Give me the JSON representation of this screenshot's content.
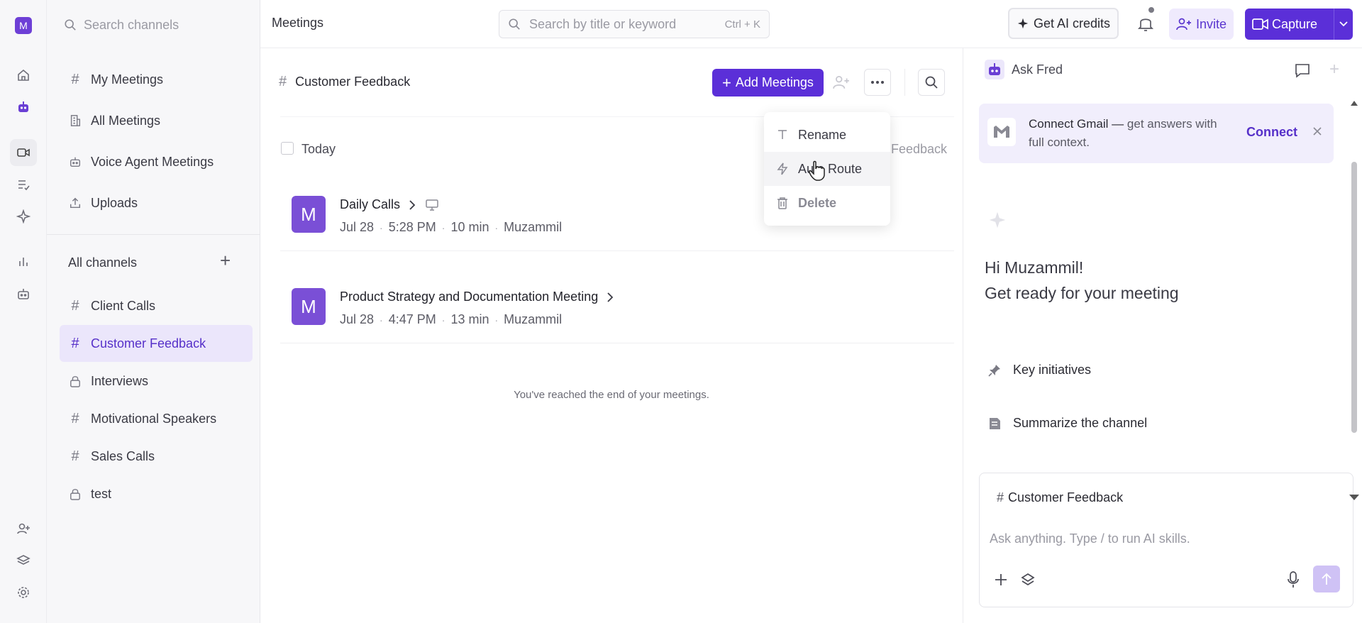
{
  "workspace": {
    "initial": "M"
  },
  "sidebar": {
    "search_placeholder": "Search channels",
    "nav": [
      {
        "label": "My Meetings",
        "icon": "hash-icon"
      },
      {
        "label": "All Meetings",
        "icon": "building-icon"
      },
      {
        "label": "Voice Agent Meetings",
        "icon": "robot-icon"
      },
      {
        "label": "Uploads",
        "icon": "upload-icon"
      }
    ],
    "channels_header": "All channels",
    "channels": [
      {
        "label": "Client Calls",
        "icon": "hash-icon"
      },
      {
        "label": "Customer Feedback",
        "icon": "hash-icon",
        "active": true
      },
      {
        "label": "Interviews",
        "icon": "lock-icon"
      },
      {
        "label": "Motivational Speakers",
        "icon": "hash-icon"
      },
      {
        "label": "Sales Calls",
        "icon": "hash-icon"
      },
      {
        "label": "test",
        "icon": "lock-icon"
      }
    ]
  },
  "topbar": {
    "title": "Meetings",
    "search_placeholder": "Search by title or keyword",
    "search_shortcut": "Ctrl + K",
    "ai_credits_label": "Get AI credits",
    "invite_label": "Invite",
    "capture_label": "Capture"
  },
  "main": {
    "channel_title": "Customer Feedback",
    "add_meetings_label": "Add Meetings",
    "group_label": "Today",
    "partial_label": "Feedback",
    "meetings": [
      {
        "avatar": "M",
        "title": "Daily Calls",
        "date": "Jul 28",
        "time": "5:28 PM",
        "duration": "10 min",
        "owner": "Muzammil"
      },
      {
        "avatar": "M",
        "title": "Product Strategy and Documentation Meeting",
        "date": "Jul 28",
        "time": "4:47 PM",
        "duration": "13 min",
        "owner": "Muzammil"
      }
    ],
    "end_text": "You've reached the end of your meetings."
  },
  "menu": {
    "items": [
      {
        "label": "Rename",
        "icon": "text-icon"
      },
      {
        "label": "Auto Route",
        "icon": "lightning-icon"
      },
      {
        "label": "Delete",
        "icon": "trash-icon"
      }
    ]
  },
  "assistant": {
    "title": "Ask Fred",
    "connect_bold": "Connect Gmail —",
    "connect_rest": "get answers with full context.",
    "connect_label": "Connect",
    "greeting": "Hi Muzammil!",
    "subtitle": "Get ready for your meeting",
    "suggestions": [
      {
        "label": "Key initiatives",
        "icon": "pin-icon"
      },
      {
        "label": "Summarize the channel",
        "icon": "note-icon"
      }
    ],
    "context_chip": "Customer Feedback",
    "input_placeholder": "Ask anything. Type / to run AI skills."
  },
  "colors": {
    "primary": "#5b2fd8",
    "active_bg": "#ebe6fb",
    "soft": "#efeafd"
  }
}
